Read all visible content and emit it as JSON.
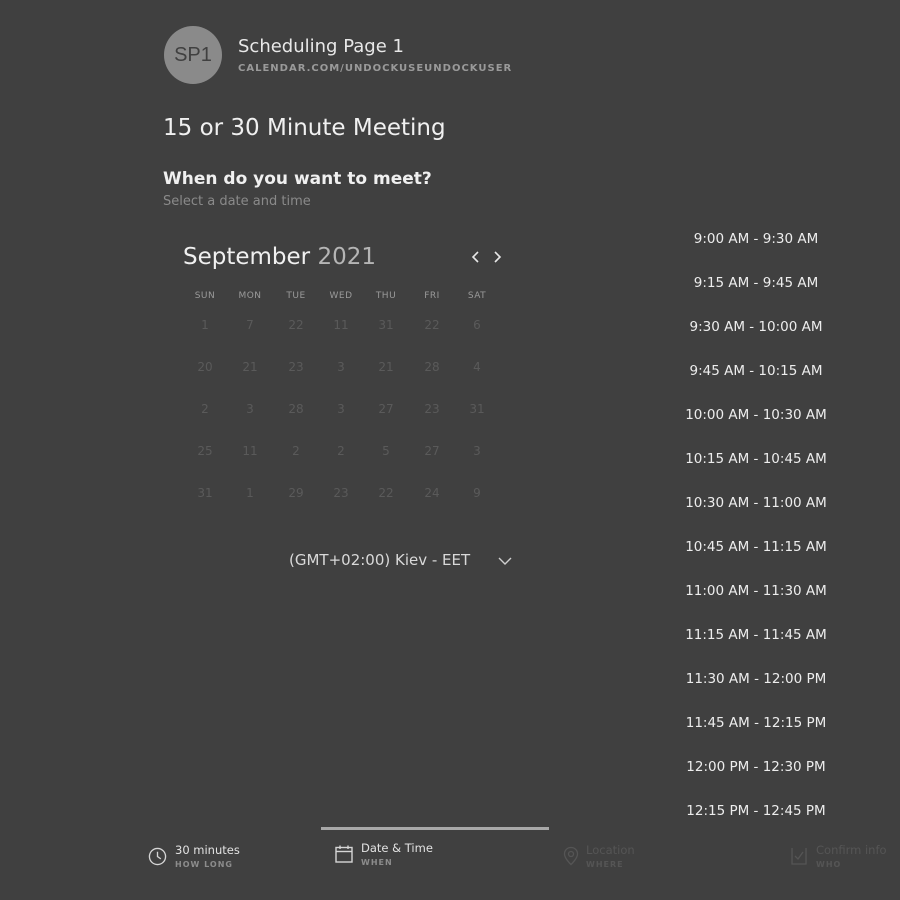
{
  "header": {
    "avatar_initials": "SP1",
    "page_name": "Scheduling Page 1",
    "page_url": "CALENDAR.COM/UNDOCKUSEUNDOCKUSER"
  },
  "meeting": {
    "title": "15 or 30 Minute Meeting",
    "question": "When do you want to meet?",
    "subtitle": "Select a date and time"
  },
  "calendar": {
    "month": "September",
    "year": "2021",
    "weekdays": [
      "SUN",
      "MON",
      "TUE",
      "WED",
      "THU",
      "FRI",
      "SAT"
    ],
    "weeks": [
      [
        "1",
        "7",
        "22",
        "11",
        "31",
        "22",
        "6"
      ],
      [
        "20",
        "21",
        "23",
        "3",
        "21",
        "28",
        "4"
      ],
      [
        "2",
        "3",
        "28",
        "3",
        "27",
        "23",
        "31"
      ],
      [
        "25",
        "11",
        "2",
        "2",
        "5",
        "27",
        "3"
      ],
      [
        "31",
        "1",
        "29",
        "23",
        "22",
        "24",
        "9"
      ]
    ]
  },
  "timezone": {
    "label": "(GMT+02:00) Kiev - EET"
  },
  "time_slots": [
    "9:00 AM - 9:30 AM",
    "9:15 AM - 9:45 AM",
    "9:30 AM - 10:00 AM",
    "9:45 AM - 10:15 AM",
    "10:00 AM - 10:30 AM",
    "10:15 AM - 10:45 AM",
    "10:30 AM - 11:00 AM",
    "10:45 AM - 11:15 AM",
    "11:00 AM - 11:30 AM",
    "11:15 AM - 11:45 AM",
    "11:30 AM - 12:00 PM",
    "11:45 AM - 12:15 PM",
    "12:00 PM - 12:30 PM",
    "12:15 PM - 12:45 PM"
  ],
  "steps": [
    {
      "title": "30 minutes",
      "subtitle": "HOW LONG",
      "icon": "clock-icon"
    },
    {
      "title": "Date & Time",
      "subtitle": "WHEN",
      "icon": "calendar-icon"
    },
    {
      "title": "Location",
      "subtitle": "WHERE",
      "icon": "location-pin-icon"
    },
    {
      "title": "Confirm info",
      "subtitle": "WHO",
      "icon": "confirm-icon"
    }
  ]
}
